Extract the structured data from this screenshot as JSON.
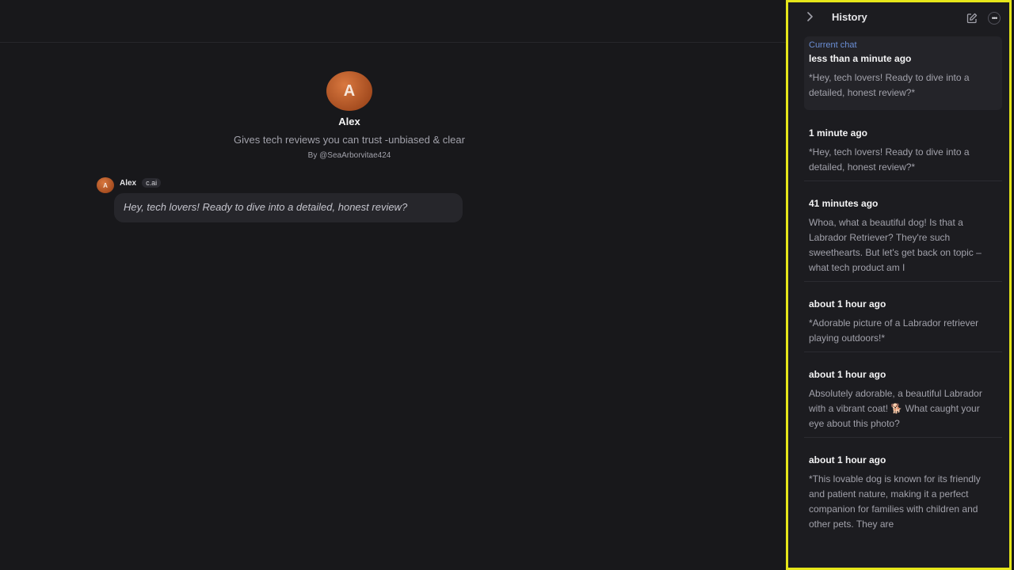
{
  "character": {
    "avatar_letter": "A",
    "name": "Alex",
    "tagline": "Gives tech reviews you can trust -unbiased & clear",
    "author": "By @SeaArborvitae424"
  },
  "message": {
    "avatar_letter": "A",
    "sender": "Alex",
    "badge": "c.ai",
    "text": "Hey, tech lovers! Ready to dive into a detailed, honest review?"
  },
  "history": {
    "title": "History",
    "current_label": "Current chat",
    "items": [
      {
        "time": "less than a minute ago",
        "preview": "*Hey, tech lovers! Ready to dive into a detailed, honest review?*"
      },
      {
        "time": "1 minute ago",
        "preview": "*Hey, tech lovers! Ready to dive into a detailed, honest review?*"
      },
      {
        "time": "41 minutes ago",
        "preview": "Whoa, what a beautiful dog! Is that a Labrador Retriever? They're such sweethearts. But let's get back on topic – what tech product am I"
      },
      {
        "time": "about 1 hour ago",
        "preview": "*Adorable picture of a Labrador retriever playing outdoors!*"
      },
      {
        "time": "about 1 hour ago",
        "preview": "Absolutely adorable, a beautiful Labrador with a vibrant coat! 🐕 What caught your eye about this photo?"
      },
      {
        "time": "about 1 hour ago",
        "preview": "*This lovable dog is known for its friendly and patient nature, making it a perfect companion for families with children and other pets. They are"
      }
    ]
  },
  "icons": {
    "collapse": "chevron-right-icon",
    "new_chat": "edit-icon",
    "more": "more-icon"
  },
  "colors": {
    "background": "#18181b",
    "sidebar_background": "#1c1c20",
    "highlight_border": "#e6e61a",
    "current_label": "#6b8fd6",
    "avatar": "#c1602c"
  }
}
